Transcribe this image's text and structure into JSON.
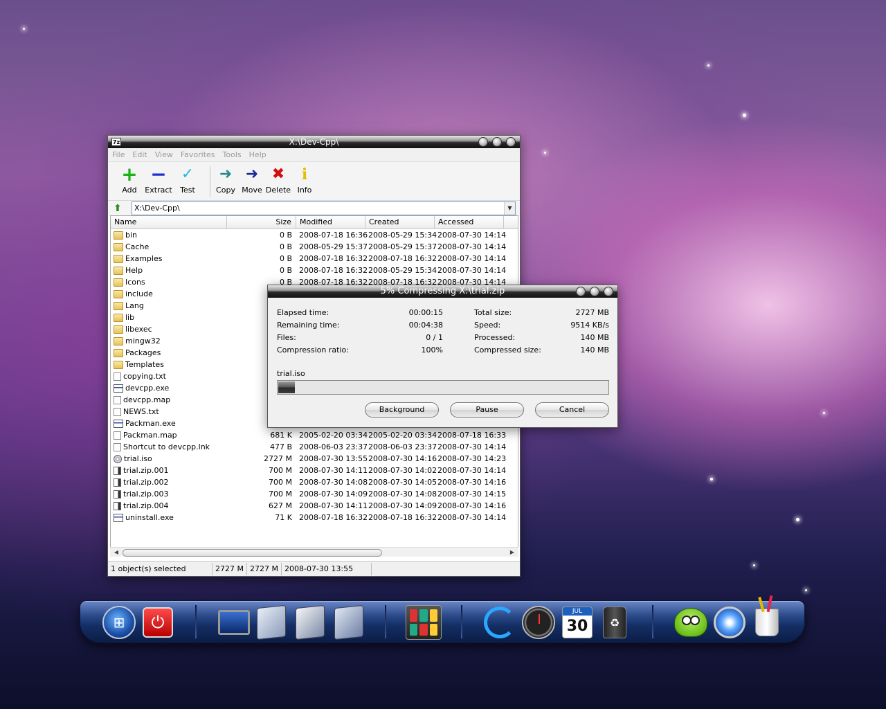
{
  "main_window": {
    "title": "X:\\Dev-Cpp\\",
    "app_icon": "7z",
    "menu": [
      "File",
      "Edit",
      "View",
      "Favorites",
      "Tools",
      "Help"
    ],
    "toolbar": [
      {
        "label": "Add",
        "icon": "plus-icon",
        "color": "#19b319"
      },
      {
        "label": "Extract",
        "icon": "minus-icon",
        "color": "#1f2fd0"
      },
      {
        "label": "Test",
        "icon": "check-icon",
        "color": "#2ab6e0"
      },
      {
        "label": "Copy",
        "icon": "copy-arrow-icon",
        "color": "#2a8a8a"
      },
      {
        "label": "Move",
        "icon": "move-arrow-icon",
        "color": "#1c2a9a"
      },
      {
        "label": "Delete",
        "icon": "x-icon",
        "color": "#d01010"
      },
      {
        "label": "Info",
        "icon": "info-icon",
        "color": "#e0c000"
      }
    ],
    "address": "X:\\Dev-Cpp\\",
    "columns": [
      "Name",
      "Size",
      "Modified",
      "Created",
      "Accessed"
    ],
    "files": [
      {
        "icon": "folder",
        "name": "bin",
        "size": "0 B",
        "modified": "2008-07-18 16:36",
        "created": "2008-05-29 15:34",
        "accessed": "2008-07-30 14:14"
      },
      {
        "icon": "folder",
        "name": "Cache",
        "size": "0 B",
        "modified": "2008-05-29 15:37",
        "created": "2008-05-29 15:37",
        "accessed": "2008-07-30 14:14"
      },
      {
        "icon": "folder",
        "name": "Examples",
        "size": "0 B",
        "modified": "2008-07-18 16:32",
        "created": "2008-07-18 16:32",
        "accessed": "2008-07-30 14:14"
      },
      {
        "icon": "folder",
        "name": "Help",
        "size": "0 B",
        "modified": "2008-07-18 16:32",
        "created": "2008-05-29 15:34",
        "accessed": "2008-07-30 14:14"
      },
      {
        "icon": "folder",
        "name": "Icons",
        "size": "0 B",
        "modified": "2008-07-18 16:32",
        "created": "2008-07-18 16:32",
        "accessed": "2008-07-30 14:14"
      },
      {
        "icon": "folder",
        "name": "include",
        "size": "",
        "modified": "",
        "created": "",
        "accessed": ""
      },
      {
        "icon": "folder",
        "name": "Lang",
        "size": "",
        "modified": "",
        "created": "",
        "accessed": ""
      },
      {
        "icon": "folder",
        "name": "lib",
        "size": "",
        "modified": "",
        "created": "",
        "accessed": ""
      },
      {
        "icon": "folder",
        "name": "libexec",
        "size": "",
        "modified": "",
        "created": "",
        "accessed": ""
      },
      {
        "icon": "folder",
        "name": "mingw32",
        "size": "",
        "modified": "",
        "created": "",
        "accessed": ""
      },
      {
        "icon": "folder",
        "name": "Packages",
        "size": "",
        "modified": "",
        "created": "",
        "accessed": ""
      },
      {
        "icon": "folder",
        "name": "Templates",
        "size": "",
        "modified": "",
        "created": "",
        "accessed": ""
      },
      {
        "icon": "file",
        "name": "copying.txt",
        "size": "",
        "modified": "",
        "created": "",
        "accessed": ""
      },
      {
        "icon": "exe",
        "name": "devcpp.exe",
        "size": "",
        "modified": "",
        "created": "",
        "accessed": ""
      },
      {
        "icon": "file",
        "name": "devcpp.map",
        "size": "",
        "modified": "",
        "created": "",
        "accessed": ""
      },
      {
        "icon": "file",
        "name": "NEWS.txt",
        "size": "",
        "modified": "",
        "created": "",
        "accessed": ""
      },
      {
        "icon": "exe",
        "name": "Packman.exe",
        "size": "",
        "modified": "",
        "created": "",
        "accessed": ""
      },
      {
        "icon": "file",
        "name": "Packman.map",
        "size": "681 K",
        "modified": "2005-02-20 03:34",
        "created": "2005-02-20 03:34",
        "accessed": "2008-07-18 16:33"
      },
      {
        "icon": "file",
        "name": "Shortcut to devcpp.lnk",
        "size": "477 B",
        "modified": "2008-06-03 23:37",
        "created": "2008-06-03 23:37",
        "accessed": "2008-07-30 14:14"
      },
      {
        "icon": "disc",
        "name": "trial.iso",
        "size": "2727 M",
        "modified": "2008-07-30 13:55",
        "created": "2008-07-30 14:16",
        "accessed": "2008-07-30 14:23"
      },
      {
        "icon": "part",
        "name": "trial.zip.001",
        "size": "700 M",
        "modified": "2008-07-30 14:11",
        "created": "2008-07-30 14:02",
        "accessed": "2008-07-30 14:14"
      },
      {
        "icon": "part",
        "name": "trial.zip.002",
        "size": "700 M",
        "modified": "2008-07-30 14:08",
        "created": "2008-07-30 14:05",
        "accessed": "2008-07-30 14:16"
      },
      {
        "icon": "part",
        "name": "trial.zip.003",
        "size": "700 M",
        "modified": "2008-07-30 14:09",
        "created": "2008-07-30 14:08",
        "accessed": "2008-07-30 14:15"
      },
      {
        "icon": "part",
        "name": "trial.zip.004",
        "size": "627 M",
        "modified": "2008-07-30 14:11",
        "created": "2008-07-30 14:09",
        "accessed": "2008-07-30 14:16"
      },
      {
        "icon": "exe",
        "name": "uninstall.exe",
        "size": "71 K",
        "modified": "2008-07-18 16:32",
        "created": "2008-07-18 16:32",
        "accessed": "2008-07-30 14:14"
      }
    ],
    "status": {
      "selection": "1 object(s) selected",
      "size": "2727 M",
      "packed": "2727 M",
      "date": "2008-07-30 13:55"
    }
  },
  "progress_dialog": {
    "title": "5% Compressing X:\\trial.zip",
    "left_stats": [
      {
        "label": "Elapsed time:",
        "value": "00:00:15"
      },
      {
        "label": "Remaining time:",
        "value": "00:04:38"
      },
      {
        "label": "Files:",
        "value": "0 / 1"
      },
      {
        "label": "Compression ratio:",
        "value": "100%"
      }
    ],
    "right_stats": [
      {
        "label": "Total size:",
        "value": "2727 MB"
      },
      {
        "label": "Speed:",
        "value": "9514 KB/s"
      },
      {
        "label": "Processed:",
        "value": "140 MB"
      },
      {
        "label": "Compressed size:",
        "value": "140 MB"
      }
    ],
    "current_file": "trial.iso",
    "progress_percent": 5,
    "buttons": {
      "background": "Background",
      "pause": "Pause",
      "cancel": "Cancel"
    }
  },
  "dock": {
    "calendar_month": "JUL",
    "calendar_day": "30",
    "items": [
      "start-orb-icon",
      "power-icon",
      "computer-icon",
      "documents-icon",
      "pictures-icon",
      "music-icon",
      "control-panel-icon",
      "orb-app-icon",
      "clock-icon",
      "calendar-icon",
      "recycle-bin-icon",
      "alien-icon",
      "safari-icon",
      "pencil-cup-icon"
    ]
  }
}
